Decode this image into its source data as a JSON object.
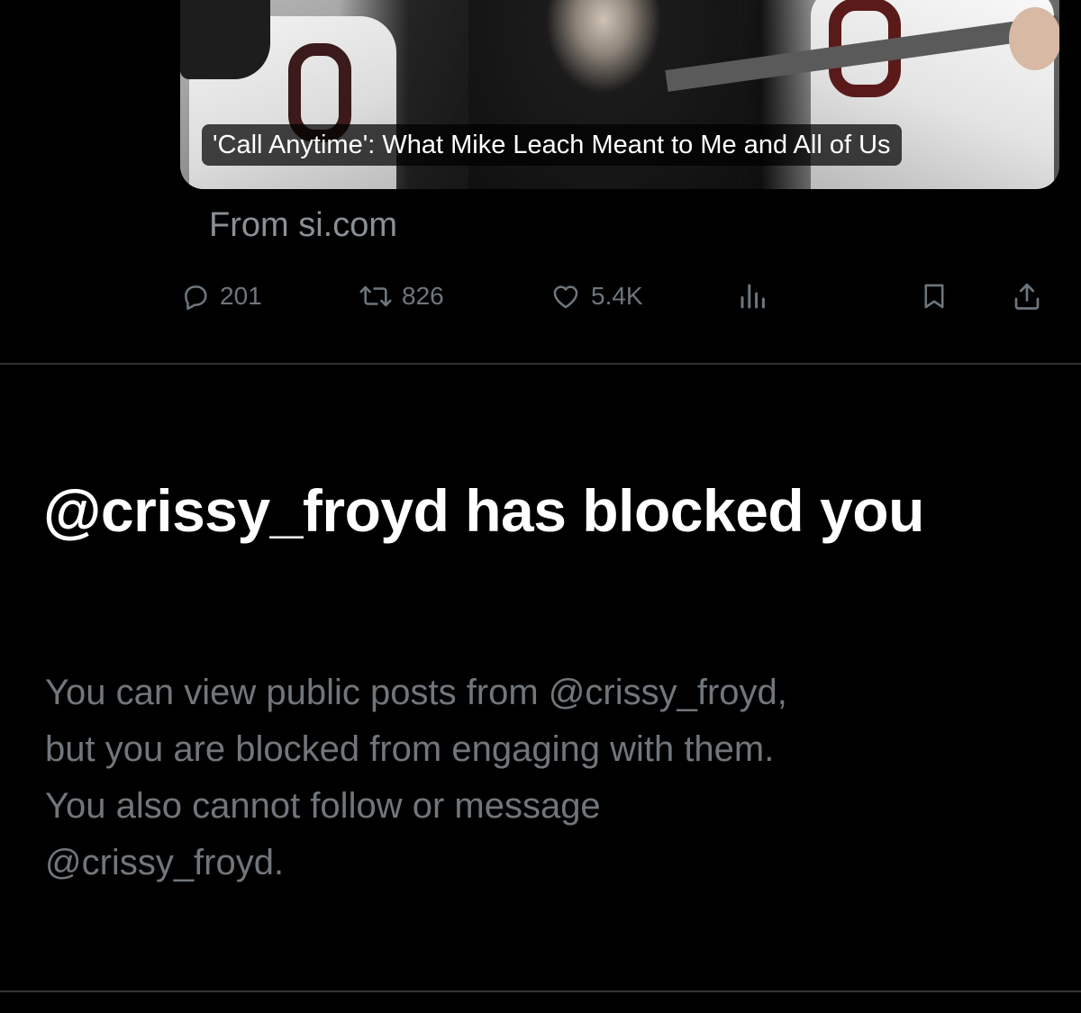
{
  "card": {
    "title": "'Call Anytime': What Mike Leach Meant to Me and All of Us",
    "source": "From si.com"
  },
  "actions": {
    "reply": {
      "icon": "reply-icon",
      "count": "201"
    },
    "repost": {
      "icon": "repost-icon",
      "count": "826"
    },
    "like": {
      "icon": "heart-icon",
      "count": "5.4K"
    },
    "views": {
      "icon": "views-chart-icon"
    },
    "bookmark": {
      "icon": "bookmark-icon"
    },
    "share": {
      "icon": "share-icon"
    }
  },
  "blocked": {
    "title": "@crissy_froyd has blocked you",
    "body_lines": [
      "You can view public posts from @crissy_froyd,",
      "but you are blocked from engaging with them.",
      "You also cannot follow or message",
      "@crissy_froyd."
    ]
  },
  "colors": {
    "background": "#000000",
    "muted_text": "#71767b",
    "icon_gray": "#6e767d",
    "divider": "#2f3336",
    "primary_text": "#ffffff"
  }
}
